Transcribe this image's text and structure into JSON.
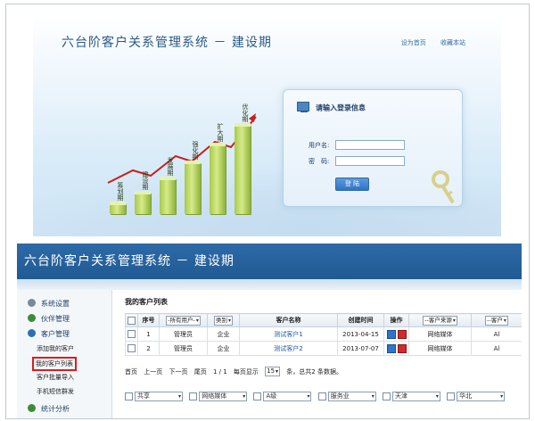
{
  "login": {
    "system_title": "六台阶客户关系管理系统 － 建设期",
    "links": [
      "设为首页",
      "收藏本站"
    ],
    "chart_bars": [
      {
        "label": "筹划期",
        "level": 0.12
      },
      {
        "label": "建设期",
        "level": 0.24
      },
      {
        "label": "发展期",
        "level": 0.4
      },
      {
        "label": "强化期",
        "level": 0.58
      },
      {
        "label": "扩大期",
        "level": 0.78
      },
      {
        "label": "优化期",
        "level": 1.0
      }
    ],
    "box_title": "请输入登录信息",
    "username_label": "用户名:",
    "password_label": "密　码:",
    "login_button": "登 陆"
  },
  "admin": {
    "system_title": "六台阶客户关系管理系统 － 建设期",
    "sidebar": {
      "sections": [
        {
          "label": "系统设置",
          "icon": "gear-icon",
          "color": "#7a8a9a"
        },
        {
          "label": "伙伴管理",
          "icon": "partner-icon",
          "color": "#3f8b3a"
        },
        {
          "label": "客户管理",
          "icon": "customer-icon",
          "color": "#2c6fb4"
        }
      ],
      "items": [
        "添加我的客户",
        "我的客户列表",
        "客户批量导入",
        "手机短信群发"
      ],
      "active_index": 1,
      "partial_section": "统计分析"
    },
    "content_title": "我的客户列表",
    "table": {
      "headers": {
        "seq": "序号",
        "owner_filter": "-所有用户-",
        "type_filter": "类别",
        "name": "客户名称",
        "created": "创建时间",
        "ops": "操作",
        "source_filter": "--客户来源",
        "region_filter": "--客户"
      },
      "rows": [
        {
          "seq": "1",
          "owner": "管理员",
          "type": "企业",
          "name": "测试客户1",
          "created": "2013-04-15",
          "source": "网络媒体",
          "region": "Al"
        },
        {
          "seq": "2",
          "owner": "管理员",
          "type": "企业",
          "name": "测试客户2",
          "created": "2013-07-07",
          "source": "网络媒体",
          "region": "Al"
        }
      ]
    },
    "pager": {
      "first": "首页",
      "prev": "上一页",
      "next": "下一页",
      "last": "尾页",
      "page_info": "1 / 1",
      "per_page_label": "每页显示",
      "per_page": "15",
      "summary": "条，总共2 条数据。"
    },
    "filters": [
      "共享",
      "网络媒体",
      "A级",
      "服务业",
      "天津",
      "华北"
    ]
  }
}
